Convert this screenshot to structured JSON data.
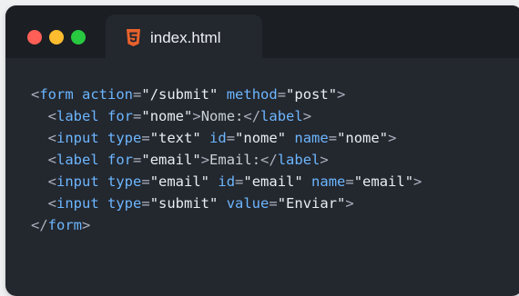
{
  "window": {
    "traffic_lights": [
      {
        "name": "close",
        "color": "#ff5f57"
      },
      {
        "name": "minimize",
        "color": "#febc2e"
      },
      {
        "name": "zoom",
        "color": "#28c840"
      }
    ]
  },
  "tab": {
    "icon": "html5-icon",
    "icon_color": "#e8622c",
    "label": "index.html"
  },
  "code": {
    "lines": [
      [
        [
          "punct",
          "<"
        ],
        [
          "tag",
          "form"
        ],
        [
          "punct",
          " "
        ],
        [
          "attr",
          "action"
        ],
        [
          "punct",
          "="
        ],
        [
          "str",
          "\"/submit\""
        ],
        [
          "punct",
          " "
        ],
        [
          "attr",
          "method"
        ],
        [
          "punct",
          "="
        ],
        [
          "str",
          "\"post\""
        ],
        [
          "punct",
          ">"
        ]
      ],
      [
        [
          "punct",
          "  <"
        ],
        [
          "tag",
          "label"
        ],
        [
          "punct",
          " "
        ],
        [
          "attr",
          "for"
        ],
        [
          "punct",
          "="
        ],
        [
          "str",
          "\"nome\""
        ],
        [
          "punct",
          ">"
        ],
        [
          "txt",
          "Nome:"
        ],
        [
          "punct",
          "</"
        ],
        [
          "tag",
          "label"
        ],
        [
          "punct",
          ">"
        ]
      ],
      [
        [
          "punct",
          "  <"
        ],
        [
          "tag",
          "input"
        ],
        [
          "punct",
          " "
        ],
        [
          "attr",
          "type"
        ],
        [
          "punct",
          "="
        ],
        [
          "str",
          "\"text\""
        ],
        [
          "punct",
          " "
        ],
        [
          "attr",
          "id"
        ],
        [
          "punct",
          "="
        ],
        [
          "str",
          "\"nome\""
        ],
        [
          "punct",
          " "
        ],
        [
          "attr",
          "name"
        ],
        [
          "punct",
          "="
        ],
        [
          "str",
          "\"nome\""
        ],
        [
          "punct",
          ">"
        ]
      ],
      [
        [
          "punct",
          "  <"
        ],
        [
          "tag",
          "label"
        ],
        [
          "punct",
          " "
        ],
        [
          "attr",
          "for"
        ],
        [
          "punct",
          "="
        ],
        [
          "str",
          "\"email\""
        ],
        [
          "punct",
          ">"
        ],
        [
          "txt",
          "Email:"
        ],
        [
          "punct",
          "</"
        ],
        [
          "tag",
          "label"
        ],
        [
          "punct",
          ">"
        ]
      ],
      [
        [
          "punct",
          "  <"
        ],
        [
          "tag",
          "input"
        ],
        [
          "punct",
          " "
        ],
        [
          "attr",
          "type"
        ],
        [
          "punct",
          "="
        ],
        [
          "str",
          "\"email\""
        ],
        [
          "punct",
          " "
        ],
        [
          "attr",
          "id"
        ],
        [
          "punct",
          "="
        ],
        [
          "str",
          "\"email\""
        ],
        [
          "punct",
          " "
        ],
        [
          "attr",
          "name"
        ],
        [
          "punct",
          "="
        ],
        [
          "str",
          "\"email\""
        ],
        [
          "punct",
          ">"
        ]
      ],
      [
        [
          "punct",
          "  <"
        ],
        [
          "tag",
          "input"
        ],
        [
          "punct",
          " "
        ],
        [
          "attr",
          "type"
        ],
        [
          "punct",
          "="
        ],
        [
          "str",
          "\"submit\""
        ],
        [
          "punct",
          " "
        ],
        [
          "attr",
          "value"
        ],
        [
          "punct",
          "="
        ],
        [
          "str",
          "\"Enviar\""
        ],
        [
          "punct",
          ">"
        ]
      ],
      [
        [
          "punct",
          "</"
        ],
        [
          "tag",
          "form"
        ],
        [
          "punct",
          ">"
        ]
      ]
    ]
  }
}
